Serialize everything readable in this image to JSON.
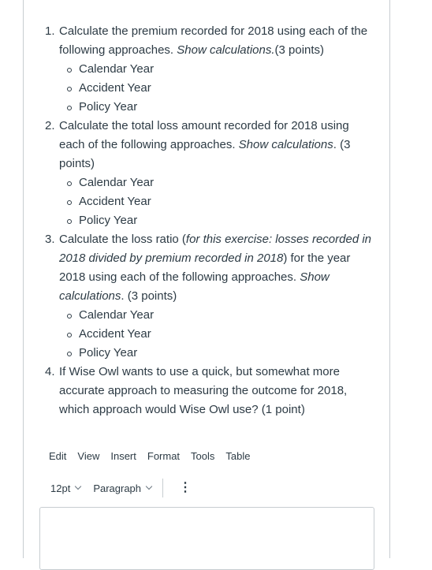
{
  "questions": [
    {
      "num": "1.",
      "text_a": "Calculate the premium recorded for 2018 using each of the following approaches. ",
      "italic_a": "Show calculations.",
      "text_b": "(3 points)",
      "items": [
        "Calendar Year",
        "Accident Year",
        "Policy Year"
      ]
    },
    {
      "num": "2.",
      "text_a": "Calculate the total loss amount recorded for 2018 using each of the following approaches. ",
      "italic_a": "Show calculations",
      "text_b": ". (3 points)",
      "items": [
        "Calendar Year",
        "Accident Year",
        "Policy Year"
      ]
    },
    {
      "num": "3.",
      "text_a": "Calculate the loss ratio (",
      "italic_a": "for this exercise: losses recorded in 2018 divided by premium recorded in 2018",
      "text_b": ") for the year 2018 using each of the following approaches. ",
      "italic_b": "Show calculations",
      "text_c": ". (3 points)",
      "items": [
        "Calendar Year",
        "Accident Year",
        "Policy Year"
      ]
    },
    {
      "num": "4.",
      "text_a": "If Wise Owl wants to use a quick, but somewhat more accurate approach to measuring the outcome for 2018, which approach would Wise Owl use? (1 point)"
    }
  ],
  "editor": {
    "menu": [
      "Edit",
      "View",
      "Insert",
      "Format",
      "Tools",
      "Table"
    ],
    "font_size": "12pt",
    "block_format": "Paragraph",
    "more_icon": "kebab-icon",
    "content": ""
  }
}
